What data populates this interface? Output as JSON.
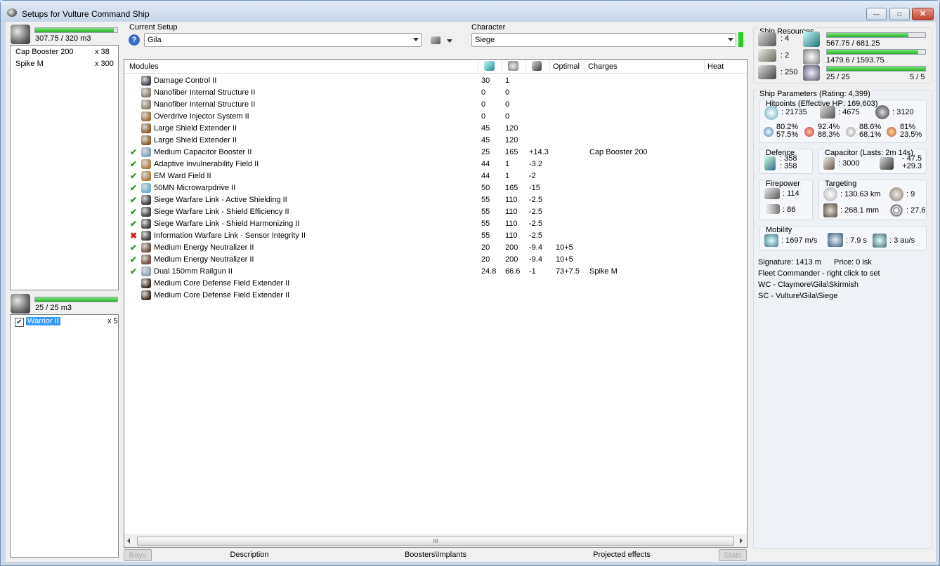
{
  "window": {
    "title": "Setups for Vulture Command Ship"
  },
  "cargo": {
    "capacity": "307.75 / 320 m3",
    "fill": 0.96,
    "items": [
      {
        "name": "Cap Booster 200",
        "qty": "x 38"
      },
      {
        "name": "Spike M",
        "qty": "x 300"
      }
    ]
  },
  "drones": {
    "capacity": "25 / 25 m3",
    "fill": 1.0,
    "items": [
      {
        "name": "Warrior II",
        "qty": "x 5",
        "checked": true
      }
    ]
  },
  "setup": {
    "label": "Current Setup",
    "value": "Gila"
  },
  "character": {
    "label": "Character",
    "value": "Siege"
  },
  "modules": {
    "headers": {
      "modules": "Modules",
      "optimal": "Optimal",
      "charges": "Charges",
      "heat": "Heat"
    },
    "rows": [
      {
        "status": "",
        "name": "Damage Control II",
        "cpu": "30",
        "pg": "1",
        "cap": "",
        "optimal": "",
        "charge": "",
        "color": "#3a3f4a"
      },
      {
        "status": "",
        "name": "Nanofiber Internal Structure II",
        "cpu": "0",
        "pg": "0",
        "cap": "",
        "optimal": "",
        "charge": "",
        "color": "#8a7a66"
      },
      {
        "status": "",
        "name": "Nanofiber Internal Structure II",
        "cpu": "0",
        "pg": "0",
        "cap": "",
        "optimal": "",
        "charge": "",
        "color": "#8a7a66"
      },
      {
        "status": "",
        "name": "Overdrive Injector System II",
        "cpu": "0",
        "pg": "0",
        "cap": "",
        "optimal": "",
        "charge": "",
        "color": "#a06a3a"
      },
      {
        "status": "",
        "name": "Large Shield Extender II",
        "cpu": "45",
        "pg": "120",
        "cap": "",
        "optimal": "",
        "charge": "",
        "color": "#8a5a2a"
      },
      {
        "status": "",
        "name": "Large Shield Extender II",
        "cpu": "45",
        "pg": "120",
        "cap": "",
        "optimal": "",
        "charge": "",
        "color": "#8a5a2a"
      },
      {
        "status": "ok",
        "name": "Medium Capacitor Booster II",
        "cpu": "25",
        "pg": "165",
        "cap": "+14.3",
        "optimal": "",
        "charge": "Cap Booster 200",
        "color": "#7aa0b8"
      },
      {
        "status": "ok",
        "name": "Adaptive Invulnerability Field II",
        "cpu": "44",
        "pg": "1",
        "cap": "-3.2",
        "optimal": "",
        "charge": "",
        "color": "#b07a3a"
      },
      {
        "status": "ok",
        "name": "EM Ward Field II",
        "cpu": "44",
        "pg": "1",
        "cap": "-2",
        "optimal": "",
        "charge": "",
        "color": "#b07a3a"
      },
      {
        "status": "ok",
        "name": "50MN Microwarpdrive II",
        "cpu": "50",
        "pg": "165",
        "cap": "-15",
        "optimal": "",
        "charge": "",
        "color": "#6ab0d0"
      },
      {
        "status": "ok",
        "name": "Siege Warfare Link - Active Shielding II",
        "cpu": "55",
        "pg": "110",
        "cap": "-2.5",
        "optimal": "",
        "charge": "",
        "color": "#3a3a3a"
      },
      {
        "status": "ok",
        "name": "Siege Warfare Link - Shield Efficiency II",
        "cpu": "55",
        "pg": "110",
        "cap": "-2.5",
        "optimal": "",
        "charge": "",
        "color": "#3a3a3a"
      },
      {
        "status": "ok",
        "name": "Siege Warfare Link - Shield Harmonizing II",
        "cpu": "55",
        "pg": "110",
        "cap": "-2.5",
        "optimal": "",
        "charge": "",
        "color": "#3a3a3a"
      },
      {
        "status": "bad",
        "name": "Information Warfare Link - Sensor Integrity II",
        "cpu": "55",
        "pg": "110",
        "cap": "-2.5",
        "optimal": "",
        "charge": "",
        "color": "#3a3a3a"
      },
      {
        "status": "ok",
        "name": "Medium Energy Neutralizer II",
        "cpu": "20",
        "pg": "200",
        "cap": "-9.4",
        "optimal": "10+5",
        "charge": "",
        "color": "#6a4a3a"
      },
      {
        "status": "ok",
        "name": "Medium Energy Neutralizer II",
        "cpu": "20",
        "pg": "200",
        "cap": "-9.4",
        "optimal": "10+5",
        "charge": "",
        "color": "#6a4a3a"
      },
      {
        "status": "ok",
        "name": "Dual 150mm Railgun II",
        "cpu": "24.8",
        "pg": "66.6",
        "cap": "-1",
        "optimal": "73+7.5",
        "charge": "Spike M",
        "color": "#8aa0b0"
      },
      {
        "status": "",
        "name": "Medium Core Defense Field Extender II",
        "cpu": "",
        "pg": "",
        "cap": "",
        "optimal": "",
        "charge": "",
        "color": "#3a2a1a"
      },
      {
        "status": "",
        "name": "Medium Core Defense Field Extender II",
        "cpu": "",
        "pg": "",
        "cap": "",
        "optimal": "",
        "charge": "",
        "color": "#3a2a1a"
      }
    ]
  },
  "resources": {
    "title": "Ship Resources",
    "turrets": ": 4",
    "launchers": ": 2",
    "calibration": ": 250",
    "cpu": {
      "text": "567.75 / 681.25",
      "fill": 0.83
    },
    "powergrid": {
      "text": "1479.6 / 1593.75",
      "fill": 0.93
    },
    "drone_bw": {
      "text": "25 / 25",
      "fill": 1.0
    },
    "drones_active": "5 / 5"
  },
  "params": {
    "title": "Ship Parameters (Rating: 4,399)",
    "hitpoints": {
      "title": "Hitpoints (Effective HP: 169,603)",
      "shield": ": 21735",
      "armor": ": 4675",
      "structure": ": 3120",
      "res": [
        {
          "a": "80.2%",
          "b": "57.5%"
        },
        {
          "a": "92.4%",
          "b": "88.3%"
        },
        {
          "a": "88.6%",
          "b": "68.1%"
        },
        {
          "a": "81%",
          "b": "23.5%"
        }
      ]
    },
    "defence": {
      "title": "Defence",
      "a": ": 358",
      "b": ": 358"
    },
    "capacitor": {
      "title": "Capacitor (Lasts: 2m 14s)",
      "amount": ": 3000",
      "use": "- 47.5",
      "recharge": "+29.3"
    },
    "firepower": {
      "title": "Firepower",
      "turret": ": 114",
      "missile": ": 86"
    },
    "targeting": {
      "title": "Targeting",
      "range": ": 130.63 km",
      "targets": ": 9",
      "scanres": ": 268.1 mm",
      "sensor": ": 27.6"
    },
    "mobility": {
      "title": "Mobility",
      "speed": ": 1697 m/s",
      "align": ": 7.9 s",
      "warp": ": 3 au/s"
    },
    "signature": "Signature: 1413 m",
    "price": "Price: 0 isk",
    "fleet": "Fleet Commander - right click to set",
    "wc": "WC - Claymore\\Gila\\Skirmish",
    "sc": "SC - Vulture\\Gila\\Siege"
  },
  "bottom": {
    "bays": "Bays",
    "description": "Description",
    "boosters": "Boosters\\Implants",
    "projected": "Projected effects",
    "stats": "Stats"
  },
  "scroll_grip": "III"
}
